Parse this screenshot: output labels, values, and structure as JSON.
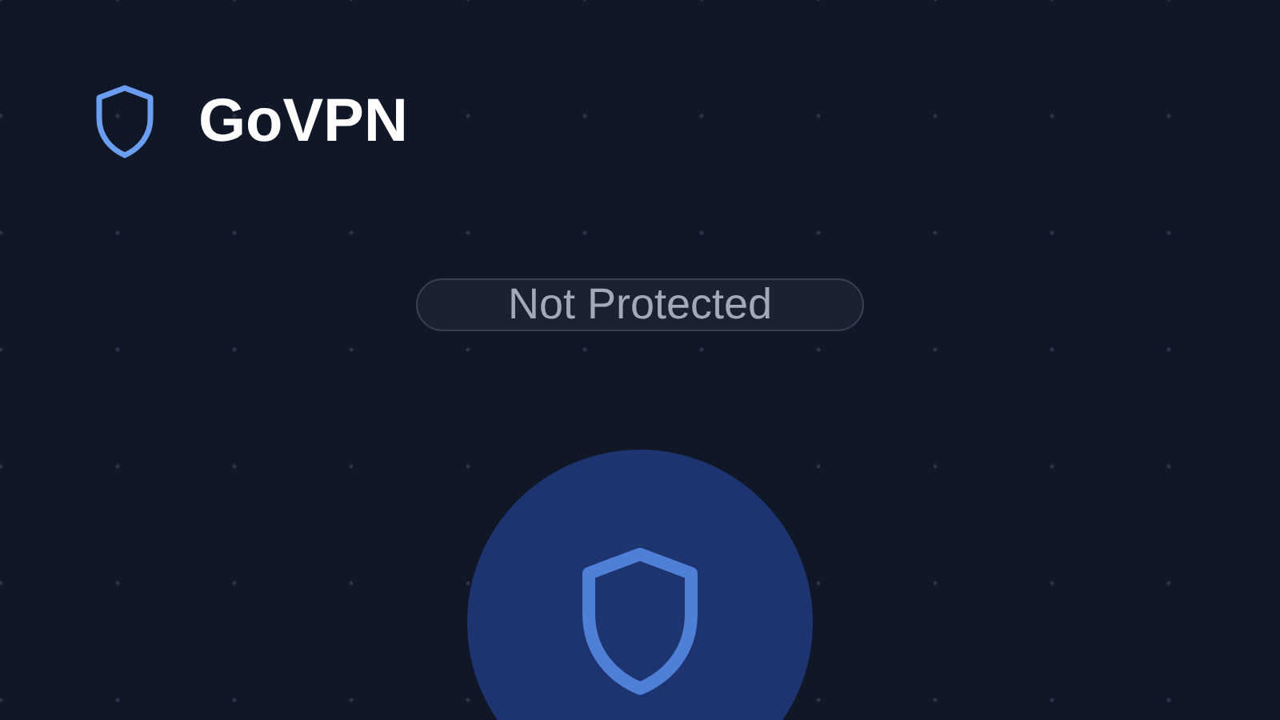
{
  "brand": {
    "name": "GoVPN"
  },
  "status": {
    "label": "Not Protected"
  }
}
